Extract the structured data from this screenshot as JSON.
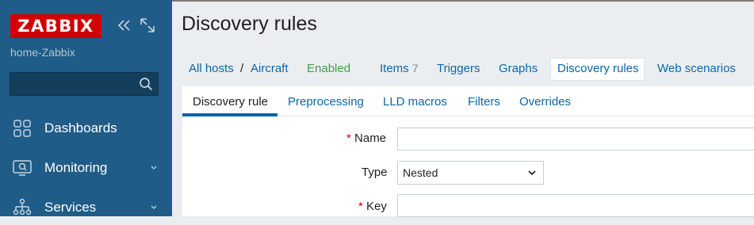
{
  "sidebar": {
    "logo": "ZABBIX",
    "collapse_icon": "collapse-icon",
    "kiosk_icon": "kiosk-icon",
    "server_name": "home-Zabbix",
    "search": {
      "value": "",
      "placeholder": "",
      "icon": "search-icon"
    },
    "menu": [
      {
        "label": "Dashboards",
        "icon": "dashboards-icon",
        "has_submenu": false
      },
      {
        "label": "Monitoring",
        "icon": "monitoring-icon",
        "has_submenu": true
      },
      {
        "label": "Services",
        "icon": "services-icon",
        "has_submenu": true
      }
    ]
  },
  "page": {
    "title": "Discovery rules"
  },
  "breadcrumb": {
    "all_hosts": "All hosts",
    "separator": "/",
    "host": "Aircraft",
    "status": "Enabled",
    "items_label": "Items",
    "items_count": "7",
    "triggers": "Triggers",
    "graphs": "Graphs",
    "discovery_rules": "Discovery rules",
    "web_scenarios": "Web scenarios"
  },
  "tabs": {
    "discovery_rule": "Discovery rule",
    "preprocessing": "Preprocessing",
    "lld_macros": "LLD macros",
    "filters": "Filters",
    "overrides": "Overrides"
  },
  "form": {
    "required_mark": "*",
    "name_label": "Name",
    "name_value": "",
    "type_label": "Type",
    "type_value": "Nested",
    "key_label": "Key",
    "key_value": ""
  },
  "colors": {
    "sidebar": "#1f5c87",
    "logo": "#d40000",
    "link": "#0a66a8",
    "enabled": "#429e47",
    "required": "#d40000"
  }
}
